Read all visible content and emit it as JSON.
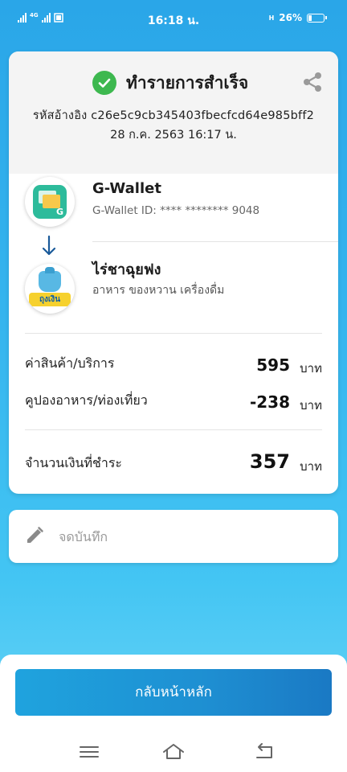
{
  "status_bar": {
    "network": "4G",
    "time": "16:18 น.",
    "battery": "26%",
    "battery_level": 0.26
  },
  "transaction": {
    "title": "ทำรายการสำเร็จ",
    "reference": "รหัสอ้างอิง c26e5c9cb345403fbecfcd64e985bff2",
    "datetime": "28 ก.ค. 2563 16:17 น."
  },
  "from": {
    "name": "G-Wallet",
    "id_text": "G-Wallet ID: **** ********  9048",
    "logo_text": "G"
  },
  "to": {
    "name": "ไร่ชาฉุยฟง",
    "description": "อาหาร ของหวาน เครื่องดื่ม",
    "logo_text": "ถุงเงิน"
  },
  "amounts": {
    "items": [
      {
        "label": "ค่าสินค้า/บริการ",
        "value": "595",
        "unit": "บาท"
      },
      {
        "label": "คูปองอาหาร/ท่องเที่ยว",
        "value": "-238",
        "unit": "บาท"
      }
    ],
    "total": {
      "label": "จำนวนเงินที่ชำระ",
      "value": "357",
      "unit": "บาท"
    }
  },
  "note": {
    "placeholder": "จดบันทึก",
    "value": ""
  },
  "home_button": {
    "label": "กลับหน้าหลัก"
  },
  "icons": {
    "success": "check-circle-icon",
    "share": "share-icon",
    "arrow": "arrow-down-icon",
    "note": "pencil-icon",
    "nav_menu": "menu-icon",
    "nav_home": "home-icon",
    "nav_back": "back-icon"
  },
  "colors": {
    "success_green": "#3db84f",
    "button_blue": "#1e8fd2",
    "background_blue": "#35b4ee"
  }
}
